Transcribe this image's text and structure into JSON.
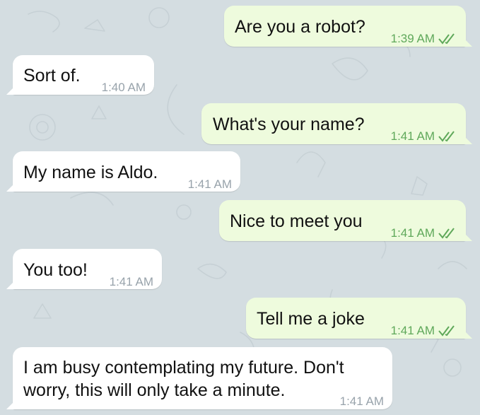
{
  "colors": {
    "background": "#d4dde1",
    "outgoing_bubble": "#eefbdd",
    "incoming_bubble": "#ffffff",
    "outgoing_time": "#5fa85a",
    "incoming_time": "#98a3ab",
    "check_marks": "#5fa85a"
  },
  "messages": [
    {
      "direction": "outgoing",
      "text": "Are you a robot?",
      "time": "1:39 AM",
      "status_icon": "double-check-icon"
    },
    {
      "direction": "incoming",
      "text": "Sort of.",
      "time": "1:40 AM"
    },
    {
      "direction": "outgoing",
      "text": "What's your name?",
      "time": "1:41 AM",
      "status_icon": "double-check-icon"
    },
    {
      "direction": "incoming",
      "text": "My name is Aldo.",
      "time": "1:41 AM"
    },
    {
      "direction": "outgoing",
      "text": "Nice to meet you",
      "time": "1:41 AM",
      "status_icon": "double-check-icon"
    },
    {
      "direction": "incoming",
      "text": "You too!",
      "time": "1:41 AM"
    },
    {
      "direction": "outgoing",
      "text": "Tell me a joke",
      "time": "1:41 AM",
      "status_icon": "double-check-icon"
    },
    {
      "direction": "incoming",
      "text_lines": [
        "I am busy contemplating my future. Don't",
        "worry, this will only take a minute."
      ],
      "time": "1:41 AM"
    }
  ]
}
